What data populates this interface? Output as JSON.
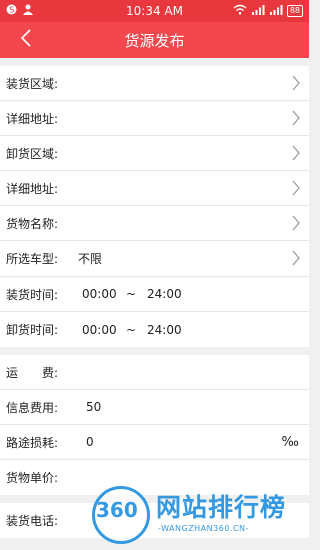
{
  "status_bar": {
    "time": "10:34 AM",
    "battery": "88",
    "left_icons": [
      "notification-icon",
      "user-icon"
    ],
    "right_icons": [
      "wifi-icon",
      "signal-icon",
      "signal-icon",
      "battery-icon"
    ]
  },
  "titlebar": {
    "title": "货源发布",
    "back_icon": "chevron-left-icon"
  },
  "sections": {
    "location": [
      {
        "label": "装货区域:",
        "value": ""
      },
      {
        "label": "详细地址:",
        "value": ""
      },
      {
        "label": "卸货区域:",
        "value": ""
      },
      {
        "label": "详细地址:",
        "value": ""
      },
      {
        "label": "货物名称:",
        "value": ""
      },
      {
        "label": "所选车型:",
        "value": "不限"
      }
    ],
    "times": [
      {
        "label": "装货时间:",
        "start": "00:00",
        "sep": "~",
        "end": "24:00"
      },
      {
        "label": "卸货时间:",
        "start": "00:00",
        "sep": "~",
        "end": "24:00"
      }
    ],
    "fees": [
      {
        "label": "运　　费:",
        "value": ""
      },
      {
        "label": "信息费用:",
        "value": "50"
      },
      {
        "label": "路途损耗:",
        "value": "0",
        "unit": "‰"
      },
      {
        "label": "货物单价:",
        "value": ""
      }
    ],
    "contact": [
      {
        "label": "装货电话:",
        "value": ""
      }
    ]
  },
  "watermark": {
    "number": "360",
    "text": "网站排行榜",
    "sub": "-WANGZHAN360.CN-"
  }
}
